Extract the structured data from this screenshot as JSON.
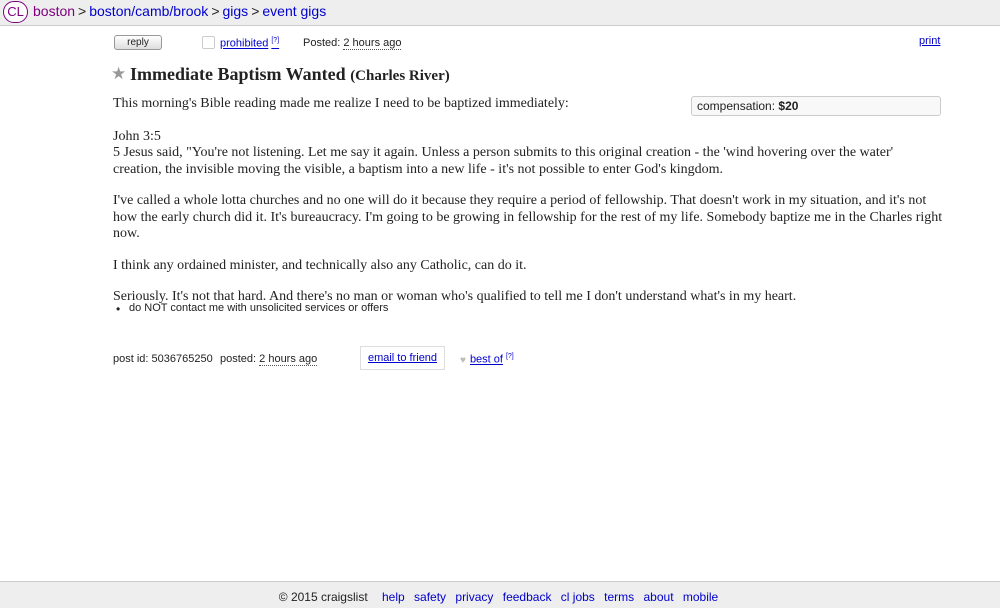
{
  "header": {
    "logo": "CL",
    "crumbs": [
      "boston",
      "boston/camb/brook",
      "gigs",
      "event gigs"
    ],
    "sep": ">"
  },
  "actions": {
    "reply": "reply",
    "prohibited": "prohibited",
    "prohibited_sup": "[?]",
    "posted_label": "Posted:",
    "posted_value": "2 hours ago",
    "print": "print"
  },
  "post": {
    "title": "Immediate Baptism Wanted",
    "location": "(Charles River)",
    "compensation_label": "compensation:",
    "compensation_value": "$20",
    "paragraphs": [
      "This morning's Bible reading made me realize I need to be baptized immediately:",
      "John 3:5\n5 Jesus said, \"You're not listening. Let me say it again. Unless a person submits to this original creation - the 'wind hovering over the water' creation, the invisible moving the visible, a baptism into a new life - it's not possible to enter God's kingdom.",
      "I've called a whole lotta churches and no one will do it because they require a period of fellowship. That doesn't work in my situation, and it's not how the early church did it. It's bureaucracy. I'm going to be growing in fellowship for the rest of my life. Somebody baptize me in the Charles right now.",
      "I think any ordained minister, and technically also any Catholic, can do it.",
      "Seriously. It's not that hard. And there's no man or woman who's qualified to tell me I don't understand what's in my heart."
    ],
    "notice": "do NOT contact me with unsolicited services or offers"
  },
  "postinfo": {
    "post_id": "post id: 5036765250",
    "posted_label": "posted:",
    "posted_value": "2 hours ago",
    "email": "email to friend",
    "best_of": "best of",
    "best_of_sup": "[?]"
  },
  "footer": {
    "copyright": "© 2015 craigslist",
    "links": [
      "help",
      "safety",
      "privacy",
      "feedback",
      "cl jobs",
      "terms",
      "about",
      "mobile"
    ]
  },
  "colors": {
    "link": "#0000cc",
    "visited": "#800080",
    "bar": "#eeeeee"
  }
}
